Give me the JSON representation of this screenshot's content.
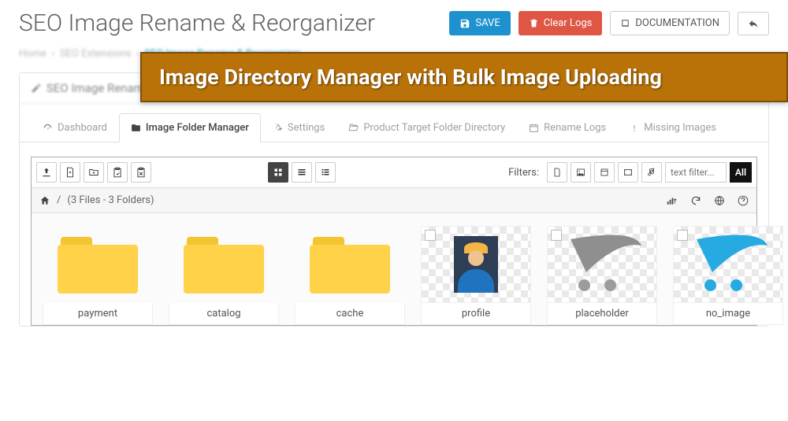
{
  "header": {
    "title": "SEO Image Rename & Reorganizer",
    "save_label": "SAVE",
    "clear_logs_label": "Clear Logs",
    "documentation_label": "DOCUMENTATION"
  },
  "breadcrumbs": {
    "home": "Home",
    "ext": "SEO Extensions",
    "current": "SEO Image Rename & Reorganizer"
  },
  "panel": {
    "heading": "SEO Image Rename & Reorganizer"
  },
  "tabs": {
    "dashboard": "Dashboard",
    "folder_manager": "Image Folder Manager",
    "settings": "Settings",
    "target_folder": "Product Target Folder Directory",
    "rename_logs": "Rename Logs",
    "missing": "Missing Images"
  },
  "toolbar": {
    "filters_label": "Filters:",
    "filter_placeholder": "text filter...",
    "all_label": "All"
  },
  "path": {
    "summary": "(3 Files - 3 Folders)"
  },
  "items": {
    "folders": [
      {
        "name": "payment"
      },
      {
        "name": "catalog"
      },
      {
        "name": "cache"
      }
    ],
    "files": [
      {
        "name": "profile"
      },
      {
        "name": "placeholder"
      },
      {
        "name": "no_image"
      }
    ]
  },
  "banner": {
    "text": "Image Directory Manager with Bulk Image Uploading"
  },
  "sep": "/"
}
